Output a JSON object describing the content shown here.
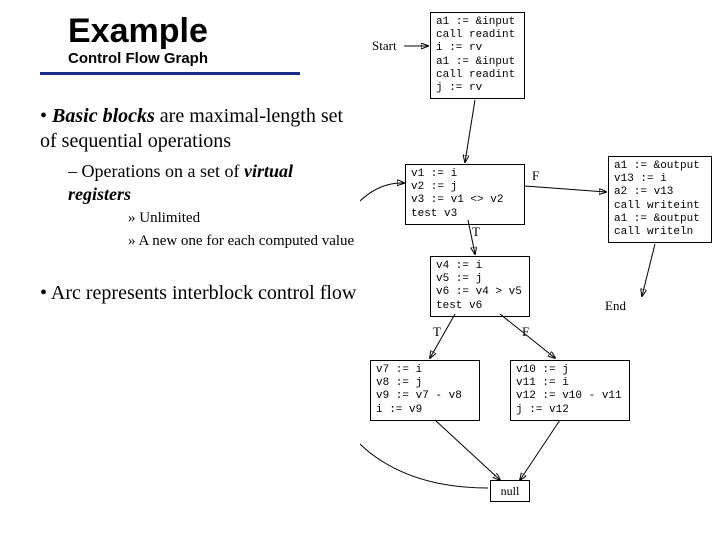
{
  "title": "Example",
  "subtitle": "Control Flow Graph",
  "bullets": {
    "b1_emph": "Basic blocks",
    "b1_rest": " are maximal-length set of sequential operations",
    "b2_pre": "Operations on a set of ",
    "b2_emph": "virtual registers",
    "b3a": "Unlimited",
    "b3b": "A new one for each computed value",
    "b4": "Arc represents interblock control flow"
  },
  "labels": {
    "start": "Start",
    "end": "End",
    "T1": "T",
    "F1": "F",
    "T2": "T",
    "F2": "F"
  },
  "nodes": {
    "n0": "a1 := &input\ncall readint\ni := rv\na1 := &input\ncall readint\nj := rv",
    "n1": "v1 := i\nv2 := j\nv3 := v1 <> v2\ntest v3",
    "n2": "a1 := &output\nv13 := i\na2 := v13\ncall writeint\na1 := &output\ncall writeln",
    "n3": "v4 := i\nv5 := j\nv6 := v4 > v5\ntest v6",
    "n4": "v7 := i\nv8 := j\nv9 := v7 - v8\ni := v9",
    "n5": "v10 := j\nv11 := i\nv12 := v10 - v11\nj := v12",
    "n6": "null"
  }
}
